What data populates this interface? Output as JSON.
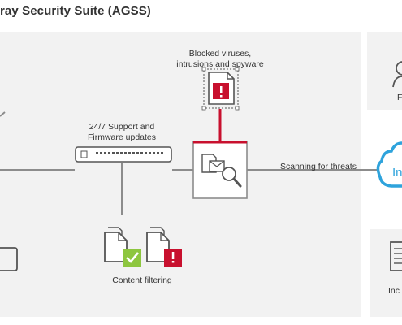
{
  "title": "ray Security Suite (AGSS)",
  "labels": {
    "blocked": "Blocked viruses,\nintrusions and spyware",
    "support": "24/7 Support and\nFirmware updates",
    "scanning": "Scanning for threats",
    "content_filtering": "Content filtering",
    "right_top_partial": "F",
    "cloud_partial": "In",
    "right_bottom_partial": "Inc"
  },
  "colors": {
    "panel_bg": "#f2f2f2",
    "line_gray": "#8c8c8c",
    "red": "#c8102e",
    "green": "#8dc63f",
    "cloud_blue": "#2ea3dc"
  },
  "icons": [
    "blocked-file-icon",
    "firewall-appliance-icon",
    "mail-scan-icon",
    "file-check-icon",
    "file-blocked-icon",
    "monitor-icon",
    "person-icon",
    "cloud-icon",
    "document-icon"
  ]
}
